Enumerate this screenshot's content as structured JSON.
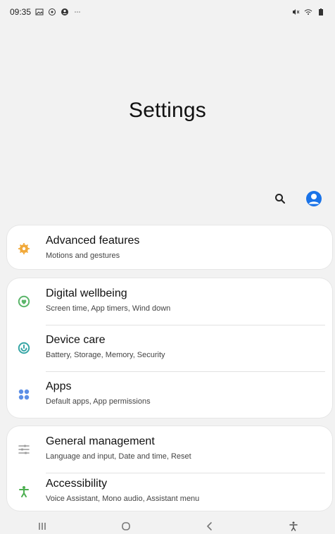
{
  "status_bar": {
    "time": "09:35",
    "left_icons": [
      "image-icon",
      "whatsapp-icon",
      "account-circle-icon",
      "more-dots-icon"
    ],
    "right_icons": [
      "mute-icon",
      "wifi-icon",
      "battery-icon"
    ]
  },
  "header": {
    "title": "Settings",
    "search_icon": "search-icon",
    "profile_icon": "profile-icon",
    "accent": "#1a73e8"
  },
  "groups": [
    {
      "items": [
        {
          "title": "Advanced features",
          "subtitle": "Motions and gestures",
          "icon": "advanced-features-icon",
          "color": "#f1a93a"
        }
      ]
    },
    {
      "items": [
        {
          "title": "Digital wellbeing",
          "subtitle": "Screen time, App timers, Wind down",
          "icon": "digital-wellbeing-icon",
          "color": "#5bb56a"
        },
        {
          "title": "Device care",
          "subtitle": "Battery, Storage, Memory, Security",
          "icon": "device-care-icon",
          "color": "#37a6a6"
        },
        {
          "title": "Apps",
          "subtitle": "Default apps, App permissions",
          "icon": "apps-icon",
          "color": "#5c8fe6"
        }
      ]
    },
    {
      "items": [
        {
          "title": "General management",
          "subtitle": "Language and input, Date and time, Reset",
          "icon": "general-management-icon",
          "color": "#8a8a8a"
        },
        {
          "title": "Accessibility",
          "subtitle": "Voice Assistant, Mono audio, Assistant menu",
          "icon": "accessibility-icon",
          "color": "#4caf50"
        }
      ]
    }
  ],
  "nav_bar": {
    "recent": "recent-apps-icon",
    "home": "home-icon",
    "back": "back-icon",
    "accessibility": "accessibility-shortcut-icon"
  }
}
